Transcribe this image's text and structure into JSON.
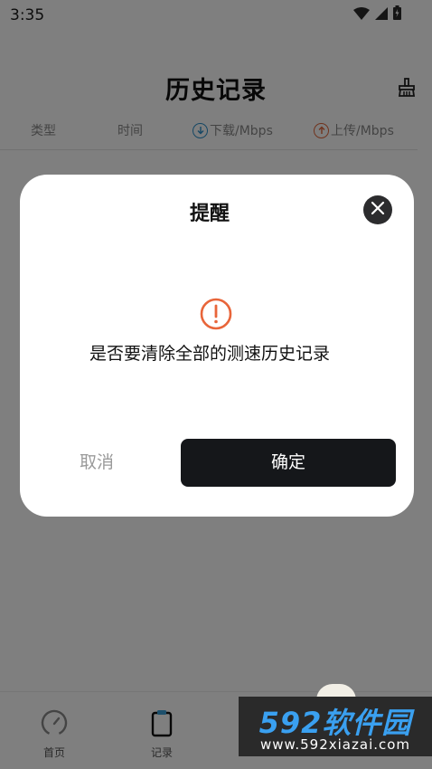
{
  "status_bar": {
    "time": "3:35"
  },
  "header": {
    "title": "历史记录"
  },
  "columns": {
    "type": "类型",
    "time": "时间",
    "download": "下载/Mbps",
    "upload": "上传/Mbps"
  },
  "nav": {
    "home": "首页",
    "records": "记录"
  },
  "dialog": {
    "title": "提醒",
    "message": "是否要清除全部的测速历史记录",
    "cancel": "取消",
    "confirm": "确定"
  },
  "watermark": {
    "brand": "592软件园",
    "url": "www.592xiazai.com"
  },
  "colors": {
    "download_accent": "#2b8fc9",
    "upload_accent": "#e0663a",
    "warning": "#e8653a",
    "confirm_bg": "#15171a",
    "overlay": "rgba(0,0,0,0.5)"
  },
  "icons": [
    "wifi-icon",
    "signal-icon",
    "battery-icon",
    "clear-broom-icon",
    "download-arrow-icon",
    "upload-arrow-icon",
    "speedometer-icon",
    "clipboard-icon",
    "close-icon",
    "warning-icon"
  ]
}
